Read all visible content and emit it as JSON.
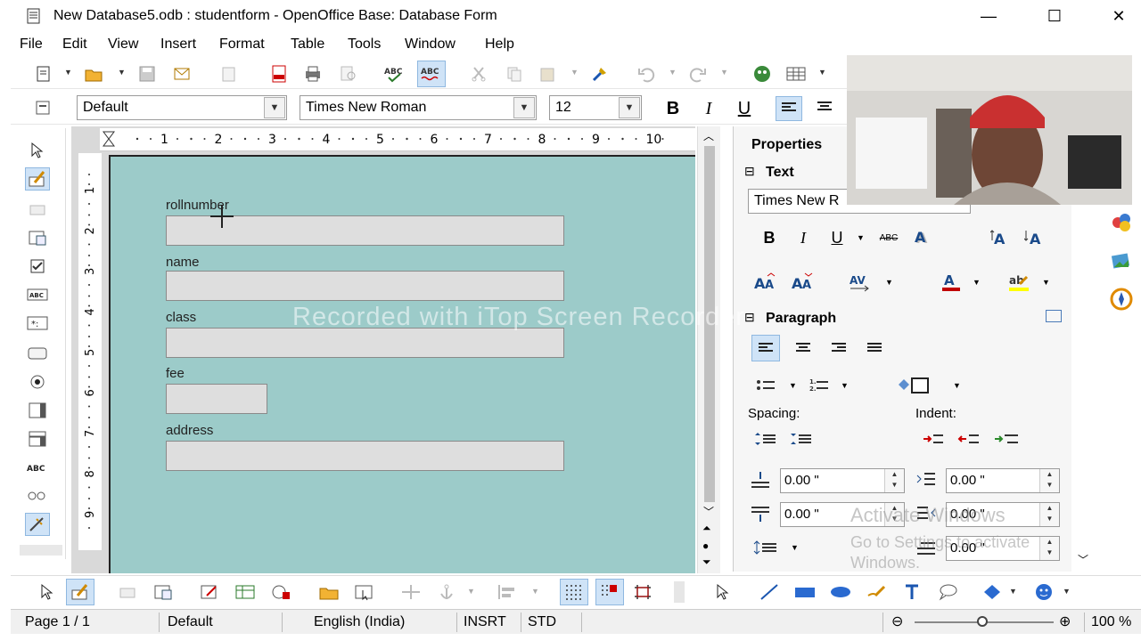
{
  "window": {
    "title": "New Database5.odb : studentform - OpenOffice Base: Database Form",
    "minimize": "—",
    "maximize": "☐",
    "close": "✕"
  },
  "menu": [
    {
      "label": "File"
    },
    {
      "label": "Edit"
    },
    {
      "label": "View"
    },
    {
      "label": "Insert"
    },
    {
      "label": "Format"
    },
    {
      "label": "Table"
    },
    {
      "label": "Tools"
    },
    {
      "label": "Window"
    },
    {
      "label": "Help"
    }
  ],
  "format_bar": {
    "paragraph_style": "Default",
    "font_name": "Times New Roman",
    "font_size": "12",
    "bold": "B",
    "italic": "I",
    "underline": "U"
  },
  "ruler": {
    "h_numbers": [
      "1",
      "2",
      "3",
      "4",
      "5",
      "6",
      "7",
      "8",
      "9",
      "10"
    ],
    "v_numbers": [
      "1",
      "2",
      "3",
      "4",
      "5",
      "6",
      "7",
      "8",
      "9"
    ]
  },
  "form": {
    "fields": [
      {
        "label": "rollnumber"
      },
      {
        "label": "name"
      },
      {
        "label": "class"
      },
      {
        "label": "fee"
      },
      {
        "label": "address"
      }
    ]
  },
  "sidebar": {
    "title": "Properties",
    "text_section": "Text",
    "font_name": "Times New R",
    "bold": "B",
    "italic": "I",
    "underline": "U",
    "strike": "ABC",
    "paragraph_section": "Paragraph",
    "spacing_label": "Spacing:",
    "indent_label": "Indent:",
    "spin_values": [
      "0.00 \"",
      "0.00 \"",
      "0.00 \"",
      "0.00 \"",
      "0.00 \""
    ],
    "collapse_glyph": "⊟"
  },
  "status": {
    "page": "Page 1 / 1",
    "style": "Default",
    "language": "English (India)",
    "insert_mode": "INSRT",
    "selection_mode": "STD",
    "zoom": "100 %"
  },
  "overlays": {
    "watermark": "Recorded with iTop Screen Recorder",
    "activate_title": "Activate Windows",
    "activate_sub": "Go to Settings to activate Windows."
  },
  "colors": {
    "form_background": "#9ccbc9",
    "field_background": "#dedede",
    "active_highlight": "#cfe3f7"
  }
}
